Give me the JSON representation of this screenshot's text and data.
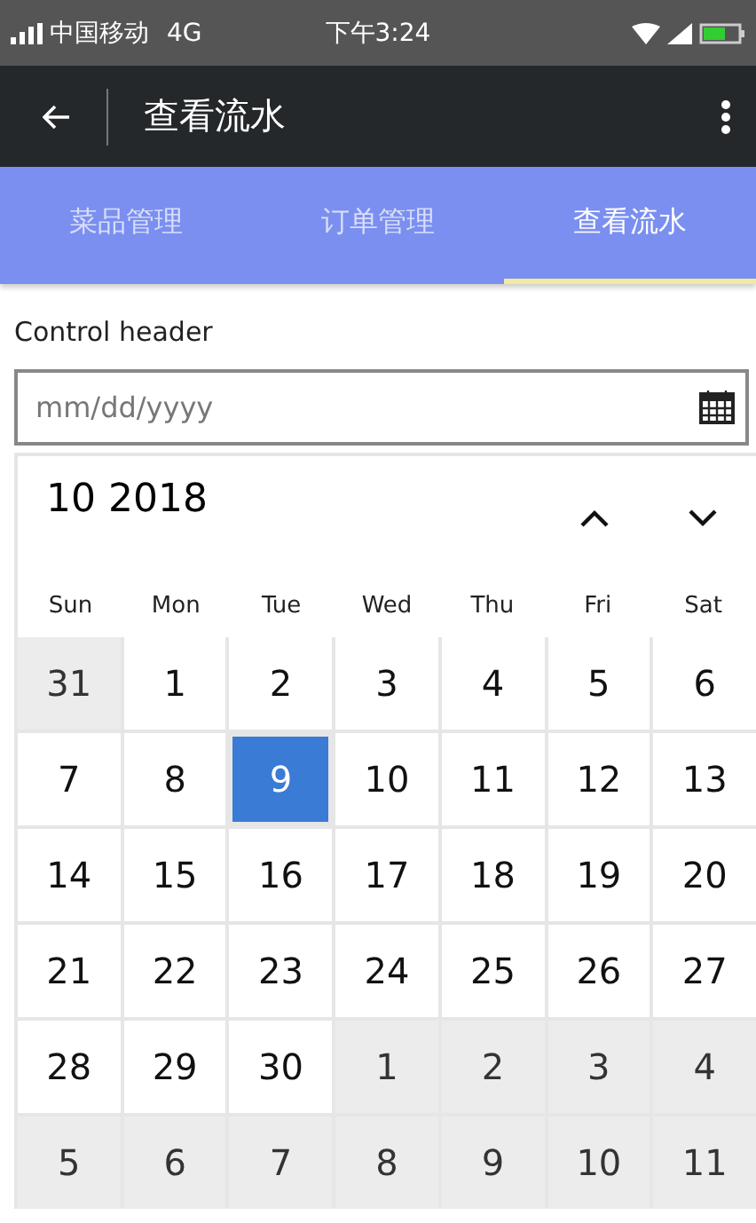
{
  "status_bar": {
    "carrier": "中国移动",
    "network": "4G",
    "time": "下午3:24"
  },
  "app_bar": {
    "title": "查看流水"
  },
  "tabs": [
    {
      "label": "菜品管理",
      "selected": false
    },
    {
      "label": "订单管理",
      "selected": false
    },
    {
      "label": "查看流水",
      "selected": true
    }
  ],
  "date_field": {
    "header": "Control header",
    "placeholder": "mm/dd/yyyy"
  },
  "calendar": {
    "month_label": "10 2018",
    "weekdays": [
      "Sun",
      "Mon",
      "Tue",
      "Wed",
      "Thu",
      "Fri",
      "Sat"
    ],
    "days": [
      {
        "label": "31",
        "in_month": false,
        "selected": false
      },
      {
        "label": "1",
        "in_month": true,
        "selected": false
      },
      {
        "label": "2",
        "in_month": true,
        "selected": false
      },
      {
        "label": "3",
        "in_month": true,
        "selected": false
      },
      {
        "label": "4",
        "in_month": true,
        "selected": false
      },
      {
        "label": "5",
        "in_month": true,
        "selected": false
      },
      {
        "label": "6",
        "in_month": true,
        "selected": false
      },
      {
        "label": "7",
        "in_month": true,
        "selected": false
      },
      {
        "label": "8",
        "in_month": true,
        "selected": false
      },
      {
        "label": "9",
        "in_month": true,
        "selected": true
      },
      {
        "label": "10",
        "in_month": true,
        "selected": false
      },
      {
        "label": "11",
        "in_month": true,
        "selected": false
      },
      {
        "label": "12",
        "in_month": true,
        "selected": false
      },
      {
        "label": "13",
        "in_month": true,
        "selected": false
      },
      {
        "label": "14",
        "in_month": true,
        "selected": false
      },
      {
        "label": "15",
        "in_month": true,
        "selected": false
      },
      {
        "label": "16",
        "in_month": true,
        "selected": false
      },
      {
        "label": "17",
        "in_month": true,
        "selected": false
      },
      {
        "label": "18",
        "in_month": true,
        "selected": false
      },
      {
        "label": "19",
        "in_month": true,
        "selected": false
      },
      {
        "label": "20",
        "in_month": true,
        "selected": false
      },
      {
        "label": "21",
        "in_month": true,
        "selected": false
      },
      {
        "label": "22",
        "in_month": true,
        "selected": false
      },
      {
        "label": "23",
        "in_month": true,
        "selected": false
      },
      {
        "label": "24",
        "in_month": true,
        "selected": false
      },
      {
        "label": "25",
        "in_month": true,
        "selected": false
      },
      {
        "label": "26",
        "in_month": true,
        "selected": false
      },
      {
        "label": "27",
        "in_month": true,
        "selected": false
      },
      {
        "label": "28",
        "in_month": true,
        "selected": false
      },
      {
        "label": "29",
        "in_month": true,
        "selected": false
      },
      {
        "label": "30",
        "in_month": true,
        "selected": false
      },
      {
        "label": "1",
        "in_month": false,
        "selected": false
      },
      {
        "label": "2",
        "in_month": false,
        "selected": false
      },
      {
        "label": "3",
        "in_month": false,
        "selected": false
      },
      {
        "label": "4",
        "in_month": false,
        "selected": false
      },
      {
        "label": "5",
        "in_month": false,
        "selected": false
      },
      {
        "label": "6",
        "in_month": false,
        "selected": false
      },
      {
        "label": "7",
        "in_month": false,
        "selected": false
      },
      {
        "label": "8",
        "in_month": false,
        "selected": false
      },
      {
        "label": "9",
        "in_month": false,
        "selected": false
      },
      {
        "label": "10",
        "in_month": false,
        "selected": false
      },
      {
        "label": "11",
        "in_month": false,
        "selected": false
      }
    ]
  }
}
